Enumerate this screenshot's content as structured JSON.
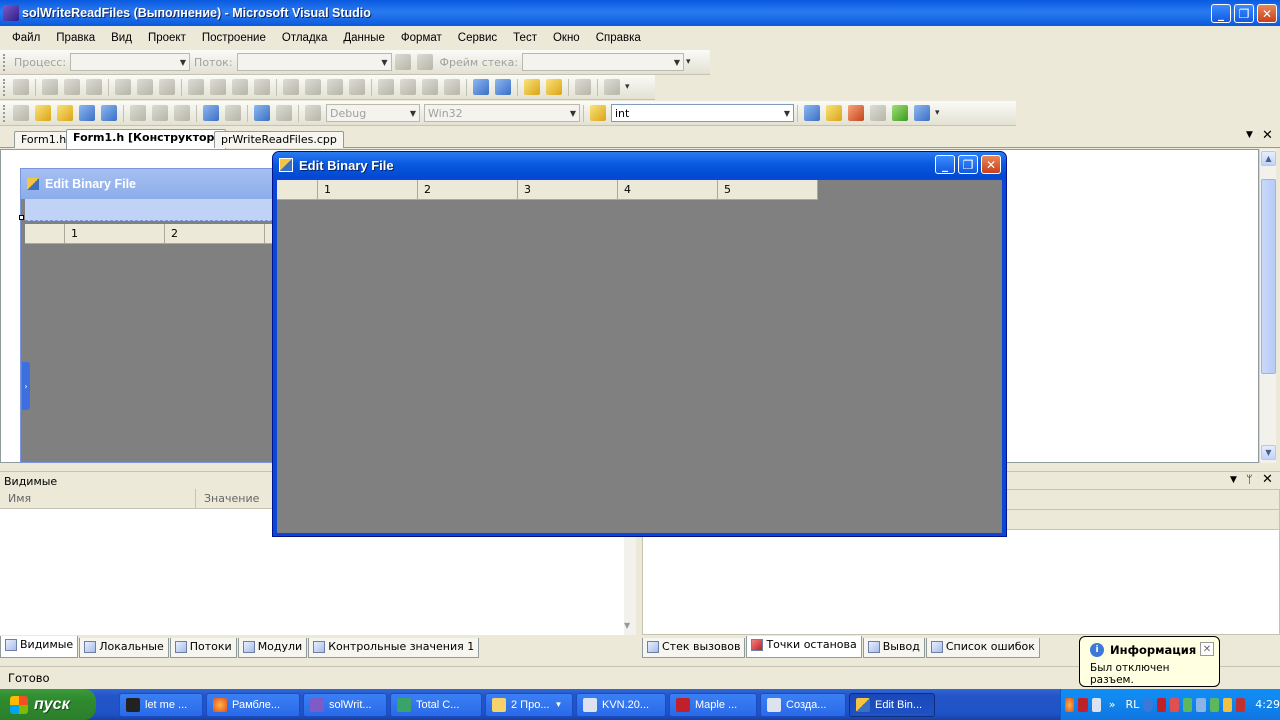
{
  "window": {
    "title": "solWriteReadFiles (Выполнение) - Microsoft Visual Studio",
    "min": "_",
    "max": "❐",
    "close": "✕"
  },
  "menu": [
    "Файл",
    "Правка",
    "Вид",
    "Проект",
    "Построение",
    "Отладка",
    "Данные",
    "Формат",
    "Сервис",
    "Тест",
    "Окно",
    "Справка"
  ],
  "debug_toolbar": {
    "process_label": "Процесс:",
    "process_value": "",
    "thread_label": "Поток:",
    "thread_value": "",
    "stackframe_label": "Фрейм стека:",
    "stackframe_value": ""
  },
  "standard_toolbar": {
    "config": "Debug",
    "platform": "Win32",
    "find_value": "int"
  },
  "doc_tabs": [
    "Form1.h",
    "Form1.h [Конструктор]",
    "prWriteReadFiles.cpp"
  ],
  "designer_form": {
    "title": "Edit Binary File",
    "grid_columns": [
      "1",
      "2"
    ]
  },
  "dialog": {
    "title": "Edit Binary File",
    "grid_columns": [
      "1",
      "2",
      "3",
      "4",
      "5"
    ]
  },
  "watch_panel": {
    "title": "Видимые",
    "columns": [
      "Имя",
      "Значение"
    ]
  },
  "left_tabs": [
    "Видимые",
    "Локальные",
    "Потоки",
    "Модули",
    "Контрольные значения 1"
  ],
  "right_tabs": [
    "Стек вызовов",
    "Точки останова",
    "Вывод",
    "Список ошибок"
  ],
  "status": "Готово",
  "balloon": {
    "title": "Информация",
    "message": "Был отключен разъем."
  },
  "taskbar": {
    "start": "пуск",
    "tasks": [
      "let me ...",
      "Рамбле...",
      "solWrit...",
      "Total C...",
      "2 Про...",
      "KVN.20...",
      "Maple ...",
      "Созда...",
      "Edit Bin..."
    ],
    "lang": "RL",
    "clock": "4:29"
  },
  "colors": {
    "xp_blue": "#0a5ae0",
    "grid_gray": "#808080",
    "start_green": "#3c9b3c"
  }
}
